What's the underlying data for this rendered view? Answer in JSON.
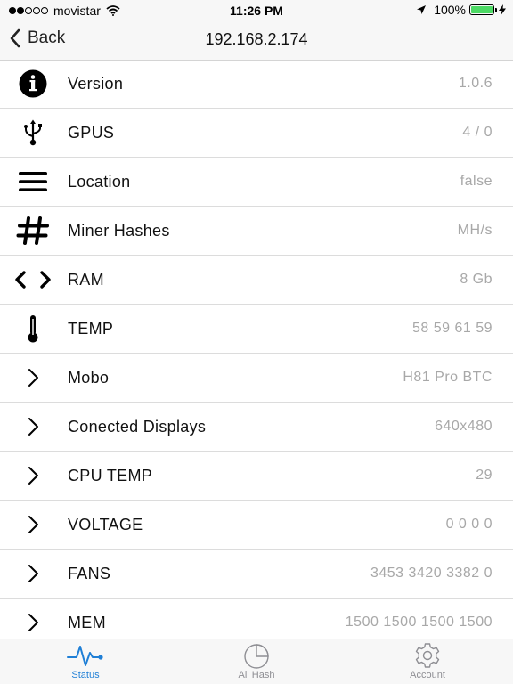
{
  "status_bar": {
    "carrier": "movistar",
    "time": "11:26 PM",
    "battery": "100%"
  },
  "nav": {
    "back_label": "Back",
    "title": "192.168.2.174"
  },
  "rows": [
    {
      "label": "Version",
      "value": "1.0.6",
      "icon": "info-icon"
    },
    {
      "label": "GPUS",
      "value": "4 / 0",
      "icon": "usb-icon"
    },
    {
      "label": "Location",
      "value": "false",
      "icon": "menu-lines-icon"
    },
    {
      "label": "Miner Hashes",
      "value": "MH/s",
      "icon": "hash-icon"
    },
    {
      "label": "RAM",
      "value": "8 Gb",
      "icon": "code-icon"
    },
    {
      "label": "TEMP",
      "value": "58 59 61 59",
      "icon": "thermometer-icon"
    },
    {
      "label": "Mobo",
      "value": "H81 Pro BTC",
      "icon": "chevron-right-icon"
    },
    {
      "label": "Conected Displays",
      "value": "640x480",
      "icon": "chevron-right-icon"
    },
    {
      "label": "CPU TEMP",
      "value": "29",
      "icon": "chevron-right-icon"
    },
    {
      "label": "VOLTAGE",
      "value": "0 0 0 0",
      "icon": "chevron-right-icon"
    },
    {
      "label": "FANS",
      "value": "3453 3420 3382 0",
      "icon": "chevron-right-icon"
    },
    {
      "label": "MEM",
      "value": "1500 1500 1500 1500",
      "icon": "chevron-right-icon"
    }
  ],
  "tabs": [
    {
      "label": "Status",
      "icon": "pulse-icon",
      "active": true
    },
    {
      "label": "All Hash",
      "icon": "pie-chart-icon",
      "active": false
    },
    {
      "label": "Account",
      "icon": "gear-icon",
      "active": false
    }
  ],
  "colors": {
    "accent": "#1f7fd6",
    "value_text": "#a8a8a8",
    "battery": "#4cd964",
    "bar_background": "#f7f7f7"
  }
}
